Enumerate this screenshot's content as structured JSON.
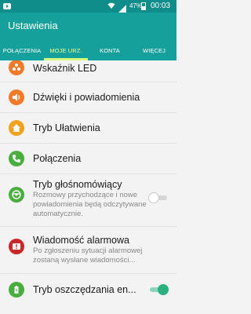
{
  "status_bar": {
    "battery": "47%",
    "time": "00:03"
  },
  "app_bar": {
    "title": "Ustawienia"
  },
  "tabs": [
    {
      "label": "POŁĄCZENIA",
      "active": false
    },
    {
      "label": "MOJE URZ.",
      "active": true
    },
    {
      "label": "KONTA",
      "active": false
    },
    {
      "label": "WIĘCEJ",
      "active": false
    }
  ],
  "settings": [
    {
      "label": "Wskaźnik LED",
      "icon": "led-indicator-icon",
      "color": "#f47a2b"
    },
    {
      "label": "Dźwięki i powiadomienia",
      "icon": "speaker-icon",
      "color": "#f47a2b"
    },
    {
      "label": "Tryb Ułatwienia",
      "icon": "home-icon",
      "color": "#f3a11f"
    },
    {
      "label": "Połączenia",
      "icon": "phone-icon",
      "color": "#49ae3d"
    },
    {
      "label": "Tryb głośnomówiący",
      "sublabel": "Rozmowy przychodzące i nowe powiadomienia będą odczytywane automatycznie.",
      "icon": "steering-wheel-icon",
      "color": "#49ae3d",
      "toggle": false
    },
    {
      "label": "Wiadomość alarmowa",
      "sublabel": "Po zgłoszeniu sytuacji alarmowej zostaną wysłane wiadomości...",
      "icon": "sos-message-icon",
      "color": "#c9282b"
    },
    {
      "label": "Tryb oszczędzania en...",
      "icon": "battery-icon",
      "color": "#49ae3d",
      "toggle": true
    }
  ],
  "colors": {
    "status_bar": "#0f8d8a",
    "app_bar": "#15a09c",
    "tab_indicator": "#d7f77f",
    "toggle_on": "#29b07f"
  }
}
